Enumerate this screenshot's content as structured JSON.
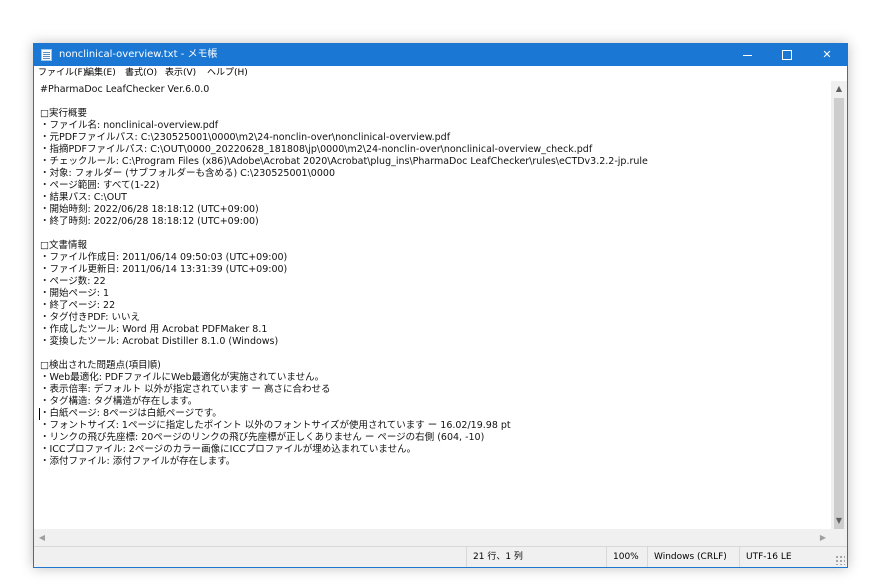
{
  "window": {
    "title": "nonclinical-overview.txt - メモ帳",
    "buttons": {
      "minimize": "—",
      "maximize": "☐",
      "close": "✕"
    }
  },
  "menu": [
    "ファイル(F)",
    "編集(E)",
    "書式(O)",
    "表示(V)",
    "ヘルプ(H)"
  ],
  "editor": {
    "lines": [
      "#PharmaDoc LeafChecker Ver.6.0.0",
      "",
      "□実行概要",
      "・ファイル名: nonclinical-overview.pdf",
      "・元PDFファイルパス: C:\\230525001\\0000\\m2\\24-nonclin-over\\nonclinical-overview.pdf",
      "・指摘PDFファイルパス: C:\\OUT\\0000_20220628_181808\\jp\\0000\\m2\\24-nonclin-over\\nonclinical-overview_check.pdf",
      "・チェックルール: C:\\Program Files (x86)\\Adobe\\Acrobat 2020\\Acrobat\\plug_ins\\PharmaDoc LeafChecker\\rules\\eCTDv3.2.2-jp.rule",
      "・対象: フォルダー (サブフォルダーも含める) C:\\230525001\\0000",
      "・ページ範囲: すべて(1-22)",
      "・結果パス: C:\\OUT",
      "・開始時刻: 2022/06/28 18:18:12 (UTC+09:00)",
      "・終了時刻: 2022/06/28 18:18:12 (UTC+09:00)",
      "",
      "□文書情報",
      "・ファイル作成日: 2011/06/14 09:50:03 (UTC+09:00)",
      "・ファイル更新日: 2011/06/14 13:31:39 (UTC+09:00)",
      "・ページ数: 22",
      "・開始ページ: 1",
      "・終了ページ: 22",
      "・タグ付きPDF: いいえ",
      "・作成したツール: Word 用 Acrobat PDFMaker 8.1",
      "・変換したツール: Acrobat Distiller 8.1.0 (Windows)",
      "",
      "□検出された問題点(項目順)",
      "・Web最適化: PDFファイルにWeb最適化が実施されていません。",
      "・表示倍率: デフォルト 以外が指定されています ー 高さに合わせる",
      "・タグ構造: タグ構造が存在します。",
      "・白紙ページ: 8ページは白紙ページです。",
      "・フォントサイズ: 1ページに指定したポイント 以外のフォントサイズが使用されています ー 16.02/19.98 pt",
      "・リンクの飛び先座標: 20ページのリンクの飛び先座標が正しくありません ー ページの右側 (604, -10)",
      "・ICCプロファイル: 2ページのカラー画像にICCプロファイルが埋め込まれていません。",
      "・添付ファイル: 添付ファイルが存在します。"
    ]
  },
  "scroll": {
    "up": "▲",
    "down": "▼",
    "left": "◀",
    "right": "▶"
  },
  "status": {
    "position": "21 行、1 列",
    "zoom": "100%",
    "line_ending": "Windows (CRLF)",
    "encoding": "UTF-16 LE"
  },
  "colors": {
    "titlebar": "#1a78d4",
    "chrome": "#f0f0f0"
  }
}
